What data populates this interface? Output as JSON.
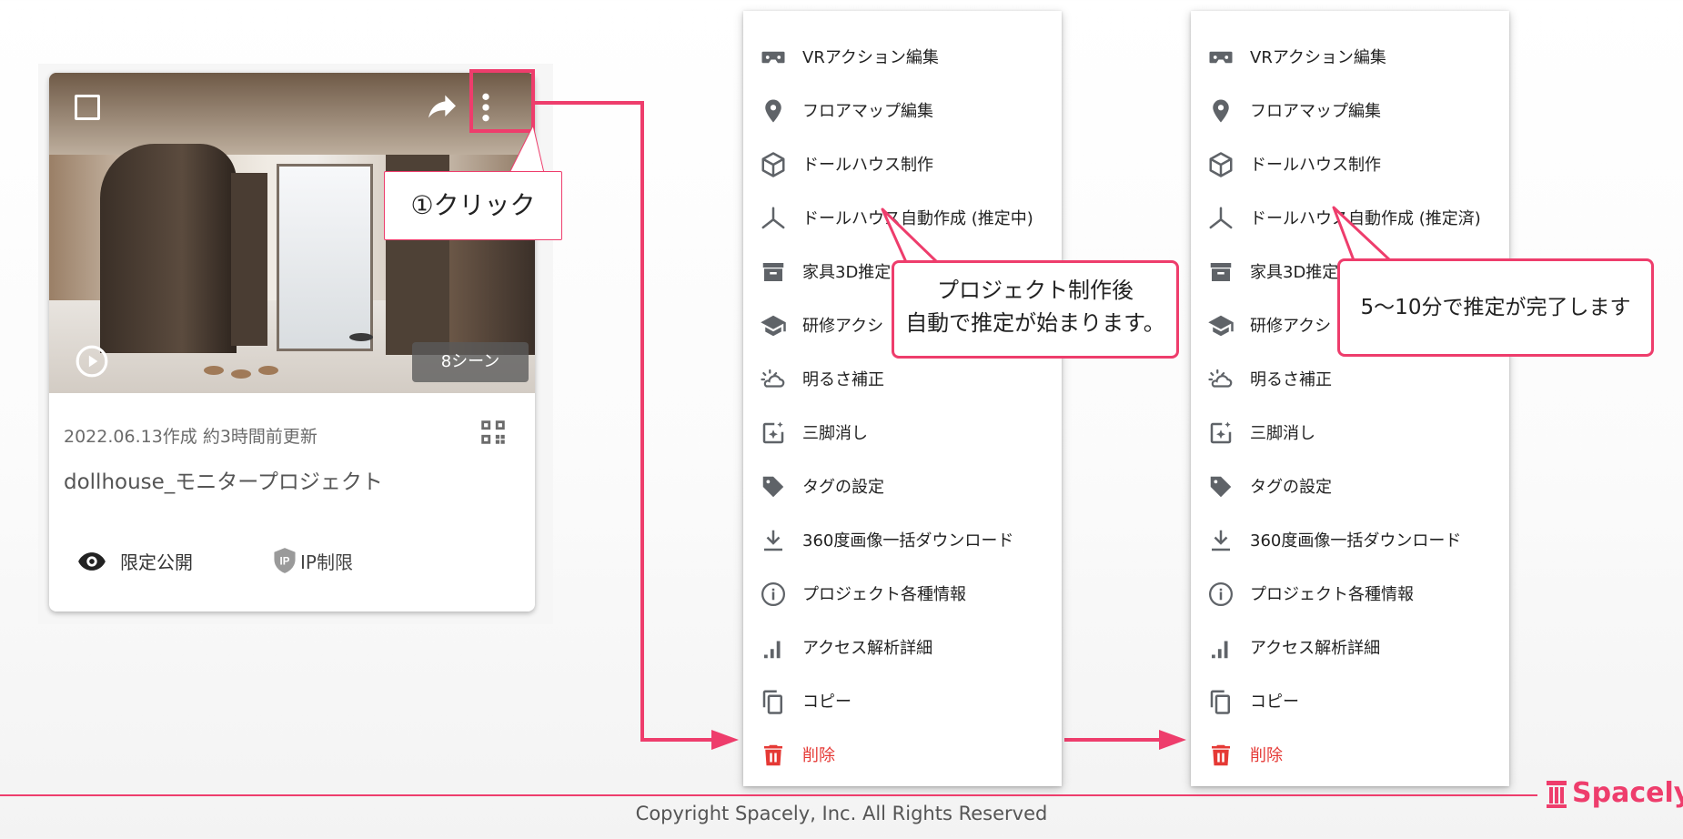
{
  "card": {
    "scene_badge": "8シーン",
    "date_info": "2022.06.13作成 約3時間前更新",
    "title": "dollhouse_モニタープロジェクト",
    "visibility_label": "限定公開",
    "ip_label": "IP制限"
  },
  "callouts": {
    "click": "①クリック",
    "start_line1": "プロジェクト制作後",
    "start_line2": "自動で推定が始まります。",
    "done": "5〜10分で推定が完了します"
  },
  "menu_before": {
    "items": [
      {
        "label": "VRアクション編集",
        "icon": "vr-headset-icon"
      },
      {
        "label": "フロアマップ編集",
        "icon": "map-pin-icon"
      },
      {
        "label": "ドールハウス制作",
        "icon": "cube-icon"
      },
      {
        "label": "ドールハウス自動作成 (推定中)",
        "icon": "axis-icon"
      },
      {
        "label": "家具3D推定",
        "icon": "archive-icon"
      },
      {
        "label": "研修アクシ",
        "icon": "graduation-cap-icon"
      },
      {
        "label": "明るさ補正",
        "icon": "weather-icon"
      },
      {
        "label": "三脚消し",
        "icon": "sparkle-image-icon"
      },
      {
        "label": "タグの設定",
        "icon": "tag-icon"
      },
      {
        "label": "360度画像一括ダウンロード",
        "icon": "download-icon"
      },
      {
        "label": "プロジェクト各種情報",
        "icon": "info-icon"
      },
      {
        "label": "アクセス解析詳細",
        "icon": "signal-bars-icon"
      },
      {
        "label": "コピー",
        "icon": "copy-icon"
      },
      {
        "label": "削除",
        "icon": "trash-icon"
      }
    ]
  },
  "menu_after": {
    "items": [
      {
        "label": "VRアクション編集",
        "icon": "vr-headset-icon"
      },
      {
        "label": "フロアマップ編集",
        "icon": "map-pin-icon"
      },
      {
        "label": "ドールハウス制作",
        "icon": "cube-icon"
      },
      {
        "label": "ドールハウス自動作成 (推定済)",
        "icon": "axis-icon"
      },
      {
        "label": "家具3D推定",
        "icon": "archive-icon"
      },
      {
        "label": "研修アクシ",
        "icon": "graduation-cap-icon"
      },
      {
        "label": "明るさ補正",
        "icon": "weather-icon"
      },
      {
        "label": "三脚消し",
        "icon": "sparkle-image-icon"
      },
      {
        "label": "タグの設定",
        "icon": "tag-icon"
      },
      {
        "label": "360度画像一括ダウンロード",
        "icon": "download-icon"
      },
      {
        "label": "プロジェクト各種情報",
        "icon": "info-icon"
      },
      {
        "label": "アクセス解析詳細",
        "icon": "signal-bars-icon"
      },
      {
        "label": "コピー",
        "icon": "copy-icon"
      },
      {
        "label": "削除",
        "icon": "trash-icon"
      }
    ]
  },
  "footer": {
    "copyright": "Copyright Spacely, Inc. All Rights Reserved",
    "brand": "Spacely"
  },
  "colors": {
    "accent": "#ee3d6c",
    "danger": "#e53935",
    "icon": "#5f6368"
  }
}
